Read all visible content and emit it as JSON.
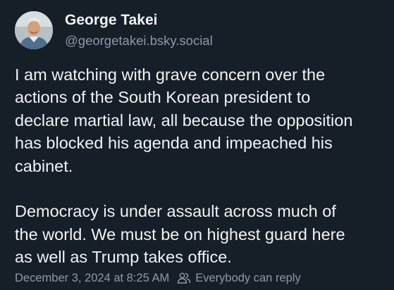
{
  "author": {
    "display_name": "George Takei",
    "handle": "@georgetakei.bsky.social",
    "avatar_icon": "profile-photo"
  },
  "post": {
    "paragraph1_lines": [
      "I am watching with grave concern over the",
      "actions of the South Korean president to",
      "declare martial law, all because the opposition",
      "has blocked his agenda and impeached his",
      "cabinet."
    ],
    "paragraph2_lines": [
      "Democracy is under assault across much of",
      "the world. We must be on highest guard here",
      "as well as Trump takes office."
    ]
  },
  "meta": {
    "timestamp": "December 3, 2024 at 8:25 AM",
    "reply_setting_icon": "people-icon",
    "reply_setting_label": "Everybody can reply"
  },
  "colors": {
    "background": "#161e27",
    "text_primary": "#f1f3f5",
    "text_secondary": "#8d9aa9"
  }
}
